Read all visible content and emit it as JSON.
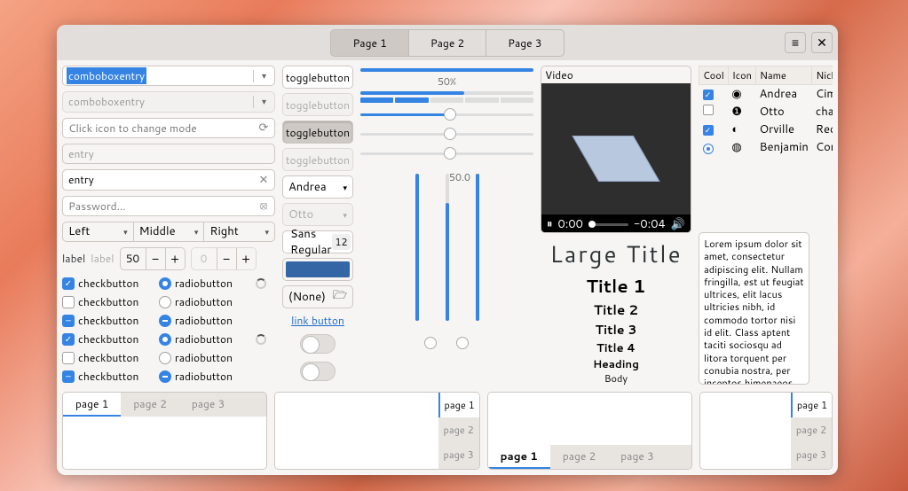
{
  "header": {
    "tabs": [
      "Page 1",
      "Page 2",
      "Page 3"
    ],
    "active_tab": 0
  },
  "combo1_value": "comboboxentry",
  "combo2_value": "comboboxentry",
  "entry_icon_placeholder": "Click icon to change mode",
  "entry_placeholder": "entry",
  "entry_value": "entry",
  "password_placeholder": "Password…",
  "align": {
    "left": "Left",
    "middle": "Middle",
    "right": "Right"
  },
  "label_row": {
    "label_text": "label",
    "label_disabled": "label",
    "spin_value": "50",
    "spin_disabled": "0"
  },
  "checkbuttons": [
    {
      "label": "checkbutton",
      "checked": true
    },
    {
      "label": "checkbutton",
      "checked": false
    },
    {
      "label": "checkbutton",
      "mixed": true
    },
    {
      "label": "checkbutton",
      "checked": true
    },
    {
      "label": "checkbutton",
      "checked": false
    },
    {
      "label": "checkbutton",
      "mixed": true
    }
  ],
  "radiobuttons": [
    {
      "label": "radiobutton",
      "checked": true
    },
    {
      "label": "radiobutton",
      "checked": false
    },
    {
      "label": "radiobutton",
      "mixed": true
    },
    {
      "label": "radiobutton",
      "checked": true
    },
    {
      "label": "radiobutton",
      "checked": false
    },
    {
      "label": "radiobutton",
      "mixed": true
    }
  ],
  "togglebutton_label": "togglebutton",
  "dropdown_people": {
    "andrea": "Andrea",
    "otto": "Otto"
  },
  "font": {
    "name": "Sans Regular",
    "size": "12"
  },
  "color": "#3465a4",
  "file_none": "(None)",
  "link_text": "link button",
  "progress_pct": "50%",
  "vscale_label": "50.0",
  "video": {
    "label": "Video",
    "cur_time": "0:00",
    "rem_time": "-0:04"
  },
  "typo": {
    "large": "Large Title",
    "t1": "Title 1",
    "t2": "Title 2",
    "t3": "Title 3",
    "t4": "Title 4",
    "heading": "Heading",
    "body": "Body"
  },
  "table": {
    "headers": [
      "Cool",
      "Icon",
      "Name",
      "Nick"
    ],
    "rows": [
      {
        "cool": true,
        "icon": "check-circle",
        "name": "Andrea",
        "nick": "Cim"
      },
      {
        "cool": false,
        "icon": "exclaim",
        "name": "Otto",
        "nick": "chao"
      },
      {
        "cool": true,
        "icon": "half-circle",
        "name": "Orville",
        "nick": "Rede"
      },
      {
        "cool": "radio",
        "icon": "globe",
        "name": "Benjamin",
        "nick": "Com"
      }
    ]
  },
  "textview": "Lorem ipsum dolor sit amet, consectetur adipiscing elit.\nNullam fringilla, est ut feugiat ultrices, elit lacus ultricies nibh, id commodo tortor nisi id elit.\nClass aptent taciti sociosqu ad litora torquent per conubia nostra, per inceptos himenaeos.\nMorbi vel elit erat. Maecenas dignissim, dui et pharetra rutrum.",
  "notebooks": {
    "pages": [
      "page 1",
      "page 2",
      "page 3"
    ]
  }
}
